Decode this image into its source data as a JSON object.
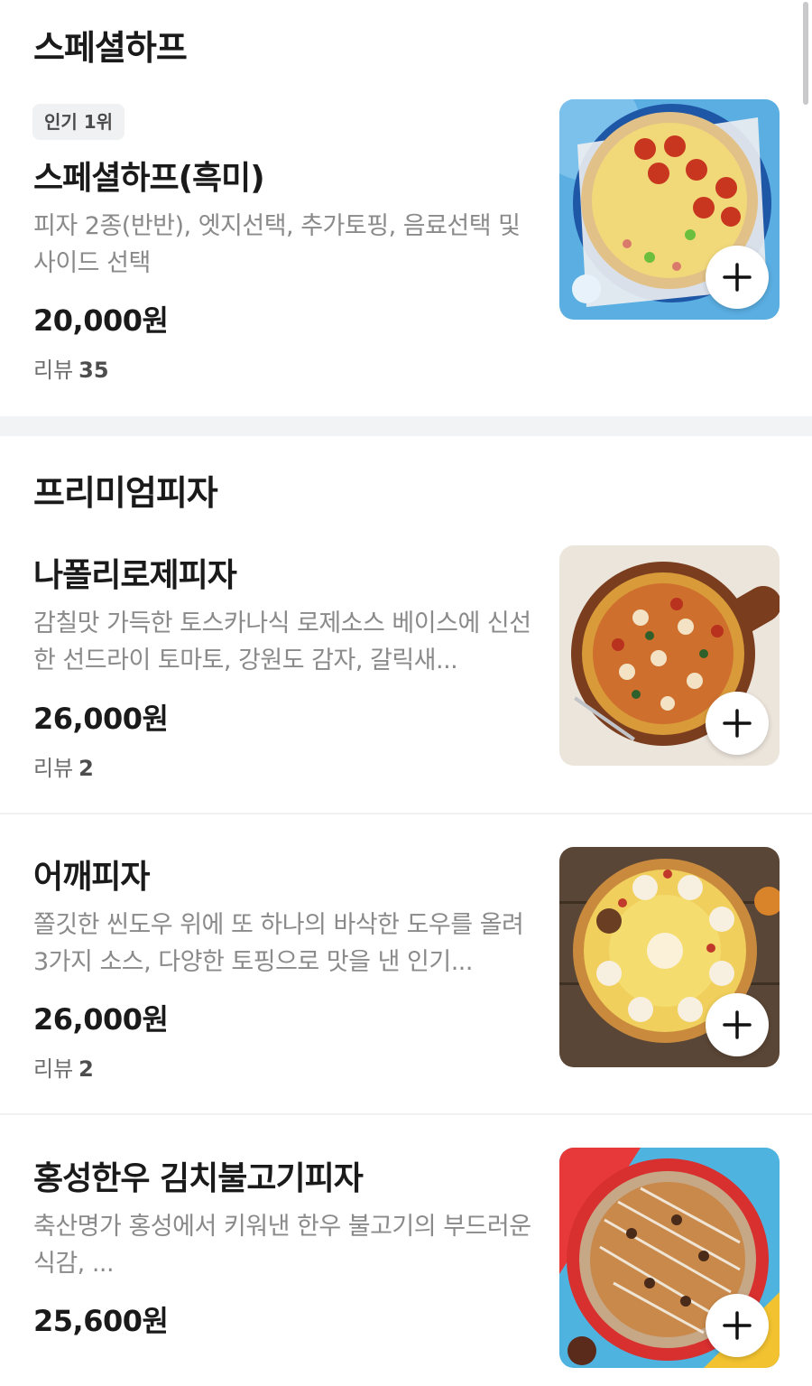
{
  "sections": [
    {
      "title": "스페셜하프",
      "items": [
        {
          "badge": "인기 1위",
          "name": "스페셜하프(흑미)",
          "description": "피자 2종(반반), 엣지선택, 추가토핑, 음료선택 및 사이드 선택",
          "price": "20,000원",
          "review_label": "리뷰",
          "review_count": "35"
        }
      ]
    },
    {
      "title": "프리미엄피자",
      "items": [
        {
          "name": "나폴리로제피자",
          "description": "감칠맛 가득한 토스카나식 로제소스 베이스에 신선한 선드라이 토마토, 강원도 감자, 갈릭새...",
          "price": "26,000원",
          "review_label": "리뷰",
          "review_count": "2"
        },
        {
          "name": "어깨피자",
          "description": "쫄깃한 씬도우 위에 또 하나의 바삭한 도우를 올려 3가지 소스, 다양한 토핑으로 맛을 낸 인기...",
          "price": "26,000원",
          "review_label": "리뷰",
          "review_count": "2"
        },
        {
          "name": "홍성한우 김치불고기피자",
          "description": "축산명가 홍성에서 키워낸 한우 불고기의 부드러운 식감, ...",
          "price": "25,600원"
        }
      ]
    }
  ],
  "icons": {
    "add": "plus-icon"
  },
  "colors": {
    "divider": "#f2f3f5",
    "badge_bg": "#f0f1f3",
    "description": "#8a8a8a"
  }
}
